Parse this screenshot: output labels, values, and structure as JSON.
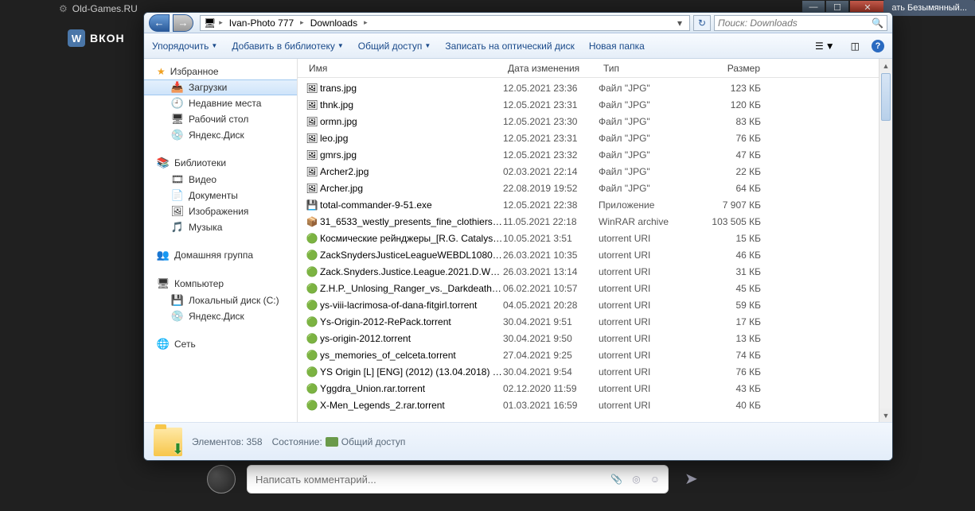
{
  "browser_tab": "Old-Games.RU",
  "taskbar_tab": "ать Безымянный...",
  "vk_text": "ВКОН",
  "comment_placeholder": "Написать комментарий...",
  "address": {
    "root_icon": "computer",
    "crumbs": [
      "Ivan-Photo 777",
      "Downloads"
    ]
  },
  "search_placeholder": "Поиск: Downloads",
  "toolbar": {
    "organize": "Упорядочить",
    "add_library": "Добавить в библиотеку",
    "share": "Общий доступ",
    "burn": "Записать на оптический диск",
    "new_folder": "Новая папка"
  },
  "nav": {
    "favorites": "Избранное",
    "downloads": "Загрузки",
    "recent": "Недавние места",
    "desktop": "Рабочий стол",
    "yandex": "Яндекс.Диск",
    "libraries": "Библиотеки",
    "videos": "Видео",
    "documents": "Документы",
    "images": "Изображения",
    "music": "Музыка",
    "homegroup": "Домашняя группа",
    "computer": "Компьютер",
    "local_c": "Локальный диск (C:)",
    "yandex2": "Яндекс.Диск",
    "network": "Сеть"
  },
  "columns": {
    "name": "Имя",
    "date": "Дата изменения",
    "type": "Тип",
    "size": "Размер"
  },
  "files": [
    {
      "icon": "img",
      "name": "trans.jpg",
      "date": "12.05.2021 23:36",
      "type": "Файл \"JPG\"",
      "size": "123 КБ"
    },
    {
      "icon": "img",
      "name": "thnk.jpg",
      "date": "12.05.2021 23:31",
      "type": "Файл \"JPG\"",
      "size": "120 КБ"
    },
    {
      "icon": "img",
      "name": "ormn.jpg",
      "date": "12.05.2021 23:30",
      "type": "Файл \"JPG\"",
      "size": "83 КБ"
    },
    {
      "icon": "img",
      "name": "leo.jpg",
      "date": "12.05.2021 23:31",
      "type": "Файл \"JPG\"",
      "size": "76 КБ"
    },
    {
      "icon": "img",
      "name": "gmrs.jpg",
      "date": "12.05.2021 23:32",
      "type": "Файл \"JPG\"",
      "size": "47 КБ"
    },
    {
      "icon": "img",
      "name": "Archer2.jpg",
      "date": "02.03.2021 22:14",
      "type": "Файл \"JPG\"",
      "size": "22 КБ"
    },
    {
      "icon": "img",
      "name": "Archer.jpg",
      "date": "22.08.2019 19:52",
      "type": "Файл \"JPG\"",
      "size": "64 КБ"
    },
    {
      "icon": "exe",
      "name": "total-commander-9-51.exe",
      "date": "12.05.2021 22:38",
      "type": "Приложение",
      "size": "7 907 КБ"
    },
    {
      "icon": "rar",
      "name": "31_6533_westly_presents_fine_clothiers_o...",
      "date": "11.05.2021 22:18",
      "type": "WinRAR archive",
      "size": "103 505 КБ"
    },
    {
      "icon": "ut",
      "name": "Космические рейнджеры_[R.G. Catalyst...",
      "date": "10.05.2021 3:51",
      "type": "utorrent URI",
      "size": "15 КБ"
    },
    {
      "icon": "ut",
      "name": "ZackSnydersJusticeLeagueWEBDL1080p.t...",
      "date": "26.03.2021 10:35",
      "type": "utorrent URI",
      "size": "46 КБ"
    },
    {
      "icon": "ut",
      "name": "Zack.Snyders.Justice.League.2021.D.WEB...",
      "date": "26.03.2021 13:14",
      "type": "utorrent URI",
      "size": "31 КБ"
    },
    {
      "icon": "ut",
      "name": "Z.H.P._Unlosing_Ranger_vs._Darkdeath_E...",
      "date": "06.02.2021 10:57",
      "type": "utorrent URI",
      "size": "45 КБ"
    },
    {
      "icon": "ut",
      "name": "ys-viii-lacrimosa-of-dana-fitgirl.torrent",
      "date": "04.05.2021 20:28",
      "type": "utorrent URI",
      "size": "59 КБ"
    },
    {
      "icon": "ut",
      "name": "Ys-Origin-2012-RePack.torrent",
      "date": "30.04.2021 9:51",
      "type": "utorrent URI",
      "size": "17 КБ"
    },
    {
      "icon": "ut",
      "name": "ys-origin-2012.torrent",
      "date": "30.04.2021 9:50",
      "type": "utorrent URI",
      "size": "13 КБ"
    },
    {
      "icon": "ut",
      "name": "ys_memories_of_celceta.torrent",
      "date": "27.04.2021 9:25",
      "type": "utorrent URI",
      "size": "74 КБ"
    },
    {
      "icon": "ut",
      "name": "YS Origin [L] [ENG] (2012) (13.04.2018) [G...",
      "date": "30.04.2021 9:54",
      "type": "utorrent URI",
      "size": "76 КБ"
    },
    {
      "icon": "ut",
      "name": "Yggdra_Union.rar.torrent",
      "date": "02.12.2020 11:59",
      "type": "utorrent URI",
      "size": "43 КБ"
    },
    {
      "icon": "ut",
      "name": "X-Men_Legends_2.rar.torrent",
      "date": "01.03.2021 16:59",
      "type": "utorrent URI",
      "size": "40 КБ"
    }
  ],
  "status": {
    "elements_label": "Элементов:",
    "elements_count": "358",
    "state_label": "Состояние:",
    "state_value": "Общий доступ"
  }
}
